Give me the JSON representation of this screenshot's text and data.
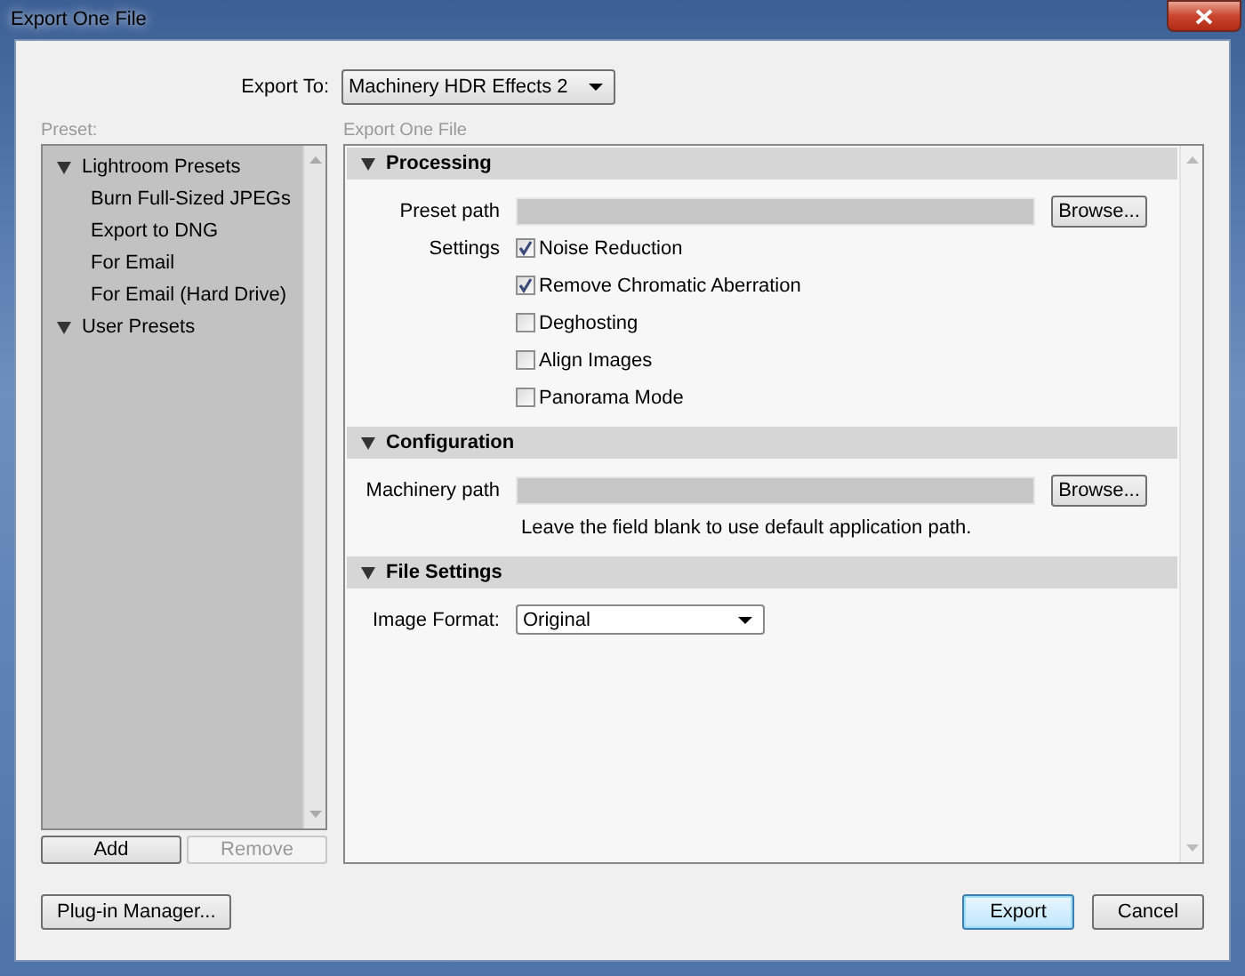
{
  "window": {
    "title": "Export One File"
  },
  "export_to": {
    "label": "Export To:",
    "value": "Machinery HDR Effects 2"
  },
  "preset_panel": {
    "label": "Preset:",
    "tree": [
      {
        "label": "Lightroom Presets",
        "expanded": true,
        "children": [
          {
            "label": "Burn Full-Sized JPEGs"
          },
          {
            "label": "Export to DNG"
          },
          {
            "label": "For Email"
          },
          {
            "label": "For Email (Hard Drive)"
          }
        ]
      },
      {
        "label": "User Presets",
        "expanded": true
      }
    ],
    "buttons": [
      {
        "label": "Add",
        "disabled": false
      },
      {
        "label": "Remove",
        "disabled": true
      }
    ]
  },
  "main_panel": {
    "label": "Export One File",
    "sections": [
      {
        "title": "Processing",
        "expanded": true,
        "rows": [
          {
            "kind": "path",
            "label": "Preset path",
            "button": "Browse..."
          },
          {
            "kind": "checkbox",
            "label": "Settings",
            "text": "Noise Reduction",
            "checked": true
          },
          {
            "kind": "checkbox",
            "text": "Remove Chromatic Aberration",
            "checked": true
          },
          {
            "kind": "checkbox",
            "text": "Deghosting",
            "checked": false
          },
          {
            "kind": "checkbox",
            "text": "Align Images",
            "checked": false
          },
          {
            "kind": "checkbox",
            "text": "Panorama Mode",
            "checked": false
          }
        ]
      },
      {
        "title": "Configuration",
        "expanded": true,
        "rows": [
          {
            "kind": "path",
            "label": "Machinery path",
            "button": "Browse..."
          },
          {
            "kind": "note",
            "text": "Leave the field blank to use default application path."
          }
        ]
      },
      {
        "title": "File Settings",
        "expanded": true,
        "rows": [
          {
            "kind": "select",
            "label": "Image Format:",
            "value": "Original"
          }
        ]
      }
    ]
  },
  "footer": {
    "left_buttons": [
      {
        "label": "Plug-in Manager...",
        "default": false
      }
    ],
    "right_buttons": [
      {
        "label": "Export",
        "default": true
      },
      {
        "label": "Cancel",
        "default": false
      }
    ]
  }
}
